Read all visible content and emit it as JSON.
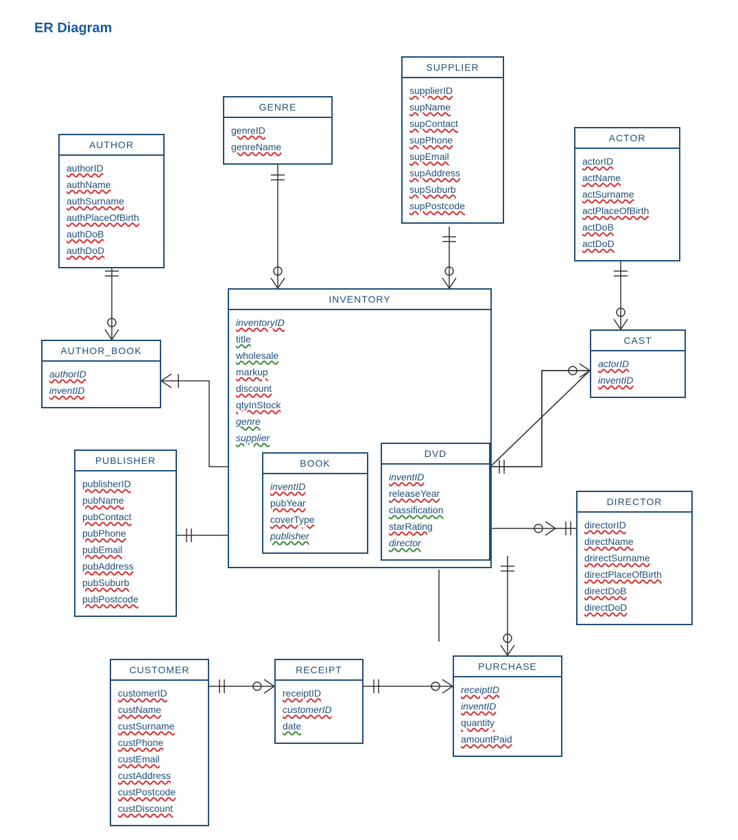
{
  "title": "ER Diagram",
  "entities": {
    "author": {
      "name": "AUTHOR",
      "attrs": [
        {
          "label": "authorID",
          "style": "red"
        },
        {
          "label": "authName",
          "style": "red"
        },
        {
          "label": "authSurname",
          "style": "red"
        },
        {
          "label": "authPlaceOfBirth",
          "style": "red"
        },
        {
          "label": "authDoB",
          "style": "red"
        },
        {
          "label": "authDoD",
          "style": "red"
        }
      ]
    },
    "genre": {
      "name": "GENRE",
      "attrs": [
        {
          "label": "genreID",
          "style": "red"
        },
        {
          "label": "genreName",
          "style": "red"
        }
      ]
    },
    "supplier": {
      "name": "SUPPLIER",
      "attrs": [
        {
          "label": "supplierID",
          "style": "red"
        },
        {
          "label": "supName",
          "style": "red"
        },
        {
          "label": "supContact",
          "style": "red"
        },
        {
          "label": "supPhone",
          "style": "red"
        },
        {
          "label": "supEmail",
          "style": "red"
        },
        {
          "label": "supAddress",
          "style": "red"
        },
        {
          "label": "supSuburb",
          "style": "red"
        },
        {
          "label": "supPostcode",
          "style": "red"
        }
      ]
    },
    "actor": {
      "name": "ACTOR",
      "attrs": [
        {
          "label": "actorID",
          "style": "red"
        },
        {
          "label": "actName",
          "style": "red"
        },
        {
          "label": "actSurname",
          "style": "red"
        },
        {
          "label": "actPlaceOfBirth",
          "style": "red"
        },
        {
          "label": "actDoB",
          "style": "red"
        },
        {
          "label": "actDoD",
          "style": "red"
        }
      ]
    },
    "author_book": {
      "name": "AUTHOR_BOOK",
      "attrs": [
        {
          "label": "authorID",
          "style": "red-italic"
        },
        {
          "label": "inventID",
          "style": "red-italic"
        }
      ]
    },
    "inventory": {
      "name": "INVENTORY",
      "attrs": [
        {
          "label": "inventoryID",
          "style": "red-italic"
        },
        {
          "label": "title",
          "style": "green"
        },
        {
          "label": "wholesale",
          "style": "green"
        },
        {
          "label": "markup",
          "style": "red"
        },
        {
          "label": "discount",
          "style": "red"
        },
        {
          "label": "qtyInStock",
          "style": "red"
        },
        {
          "label": "genre",
          "style": "green-italic"
        },
        {
          "label": "supplier",
          "style": "green-italic"
        }
      ]
    },
    "cast": {
      "name": "CAST",
      "attrs": [
        {
          "label": "actorID",
          "style": "red-italic"
        },
        {
          "label": "inventID",
          "style": "red-italic"
        }
      ]
    },
    "book": {
      "name": "BOOK",
      "attrs": [
        {
          "label": "inventID",
          "style": "red-italic"
        },
        {
          "label": "pubYear",
          "style": "red"
        },
        {
          "label": "coverType",
          "style": "red"
        },
        {
          "label": "publisher",
          "style": "green-italic"
        }
      ]
    },
    "dvd": {
      "name": "DVD",
      "attrs": [
        {
          "label": "inventID",
          "style": "red-italic"
        },
        {
          "label": "releaseYear",
          "style": "red"
        },
        {
          "label": "classification",
          "style": "green"
        },
        {
          "label": "starRating",
          "style": "red"
        },
        {
          "label": "director",
          "style": "green-italic"
        }
      ]
    },
    "publisher": {
      "name": "PUBLISHER",
      "attrs": [
        {
          "label": "publisherID",
          "style": "red"
        },
        {
          "label": "pubName",
          "style": "red"
        },
        {
          "label": "pubContact",
          "style": "red"
        },
        {
          "label": "pubPhone",
          "style": "red"
        },
        {
          "label": "pubEmail",
          "style": "red"
        },
        {
          "label": "pubAddress",
          "style": "red"
        },
        {
          "label": "pubSuburb",
          "style": "red"
        },
        {
          "label": "pubPostcode",
          "style": "red"
        }
      ]
    },
    "director": {
      "name": "DIRECTOR",
      "attrs": [
        {
          "label": "directorID",
          "style": "red"
        },
        {
          "label": "directName",
          "style": "red"
        },
        {
          "label": "drirectSurname",
          "style": "red"
        },
        {
          "label": "directPlaceOfBirth",
          "style": "red"
        },
        {
          "label": "directDoB",
          "style": "red"
        },
        {
          "label": "directDoD",
          "style": "red"
        }
      ]
    },
    "customer": {
      "name": "CUSTOMER",
      "attrs": [
        {
          "label": "customerID",
          "style": "red"
        },
        {
          "label": "custName",
          "style": "red"
        },
        {
          "label": "custSurname",
          "style": "red"
        },
        {
          "label": "custPhone",
          "style": "red"
        },
        {
          "label": "custEmail",
          "style": "red"
        },
        {
          "label": "custAddress",
          "style": "red"
        },
        {
          "label": "custPostcode",
          "style": "red"
        },
        {
          "label": "custDiscount",
          "style": "red"
        }
      ]
    },
    "receipt": {
      "name": "RECEIPT",
      "attrs": [
        {
          "label": "receiptID",
          "style": "red"
        },
        {
          "label": "customerID",
          "style": "red-italic"
        },
        {
          "label": "date",
          "style": "green"
        }
      ]
    },
    "purchase": {
      "name": "PURCHASE",
      "attrs": [
        {
          "label": "receiptID",
          "style": "red-italic"
        },
        {
          "label": "inventID",
          "style": "red-italic"
        },
        {
          "label": "quantity",
          "style": "red"
        },
        {
          "label": "amountPaid",
          "style": "red"
        }
      ]
    }
  }
}
